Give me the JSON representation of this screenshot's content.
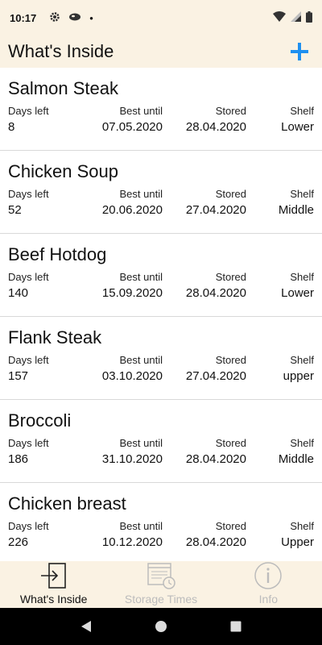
{
  "status": {
    "time": "10:17",
    "dot": "•"
  },
  "header": {
    "title": "What's Inside",
    "add_label": "+"
  },
  "column_labels": {
    "days_left": "Days left",
    "best_until": "Best until",
    "stored": "Stored",
    "shelf": "Shelf"
  },
  "items": [
    {
      "name": "Salmon Steak",
      "days_left": "8",
      "best_until": "07.05.2020",
      "stored": "28.04.2020",
      "shelf": "Lower"
    },
    {
      "name": "Chicken Soup",
      "days_left": "52",
      "best_until": "20.06.2020",
      "stored": "27.04.2020",
      "shelf": "Middle"
    },
    {
      "name": "Beef Hotdog",
      "days_left": "140",
      "best_until": "15.09.2020",
      "stored": "28.04.2020",
      "shelf": "Lower"
    },
    {
      "name": "Flank Steak",
      "days_left": "157",
      "best_until": "03.10.2020",
      "stored": "27.04.2020",
      "shelf": "upper"
    },
    {
      "name": "Broccoli",
      "days_left": "186",
      "best_until": "31.10.2020",
      "stored": "28.04.2020",
      "shelf": "Middle"
    },
    {
      "name": "Chicken breast",
      "days_left": "226",
      "best_until": "10.12.2020",
      "stored": "28.04.2020",
      "shelf": "Upper"
    }
  ],
  "bottom_nav": [
    {
      "label": "What's Inside",
      "icon": "enter-icon",
      "active": true
    },
    {
      "label": "Storage Times",
      "icon": "calendar-clock-icon",
      "active": false
    },
    {
      "label": "Info",
      "icon": "info-icon",
      "active": false
    }
  ],
  "colors": {
    "bar_background": "#faf2e3",
    "accent": "#1e90f0",
    "inactive_nav": "#bcbcbc"
  }
}
